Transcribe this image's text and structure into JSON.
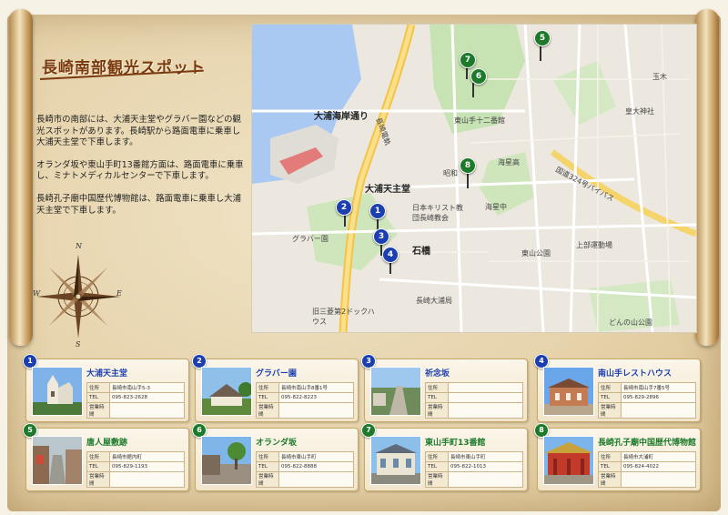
{
  "page": {
    "title": "長崎南部観光スポット",
    "intro": [
      "長崎市の南部には、大浦天主堂やグラバー園などの観光スポットがあります。長崎駅から路面電車に乗車し大浦天主堂で下車します。",
      "オランダ坂や東山手町13番館方面は、路面電車に乗車し、ミナトメディカルセンターで下車します。",
      "長崎孔子廟中国歴代博物館は、路面電車に乗車し大浦天主堂で下車します。"
    ]
  },
  "compass": {
    "n": "N",
    "s": "S",
    "e": "E",
    "w": "W"
  },
  "map": {
    "labels": {
      "oura_kaigan": "大浦海岸通り",
      "oura_tenshudo": "大浦天主堂",
      "ishibashi": "石橋",
      "glover": "グラバー園",
      "higashiyamate": "東山手十二番館",
      "kaiseiko": "海星高",
      "kaiseichu": "海星中",
      "showa": "昭和",
      "bypass": "国道324号バイパス",
      "nagasaki_oura": "長崎大浦局",
      "dock": "旧三菱第2ドックハウス",
      "donnoyama": "どんの山公園",
      "higashiyama_park": "東山公園",
      "kamiundo": "上部運動場",
      "jinja": "皇大神社",
      "tamagi": "玉木",
      "koshibyo": "日本キリスト教団長崎教会",
      "densha": "長崎電軌"
    },
    "markers": [
      "1",
      "2",
      "3",
      "4",
      "5",
      "6",
      "7",
      "8"
    ]
  },
  "labels": {
    "address": "住所",
    "tel": "TEL",
    "hours": "営業時間"
  },
  "spots": [
    {
      "num": "1",
      "name": "大浦天主堂",
      "address": "長崎市南山手5-3",
      "tel": "095-823-2628",
      "hours": ""
    },
    {
      "num": "2",
      "name": "グラバー園",
      "address": "長崎市南山手8番1号",
      "tel": "095-822-8223",
      "hours": ""
    },
    {
      "num": "3",
      "name": "祈念坂",
      "address": "",
      "tel": "",
      "hours": ""
    },
    {
      "num": "4",
      "name": "南山手レストハウス",
      "address": "長崎市南山手7番5号",
      "tel": "095-829-2896",
      "hours": ""
    },
    {
      "num": "5",
      "name": "唐人屋敷跡",
      "address": "長崎市館内町",
      "tel": "095-829-1193",
      "hours": ""
    },
    {
      "num": "6",
      "name": "オランダ坂",
      "address": "長崎市東山手町",
      "tel": "095-822-8888",
      "hours": ""
    },
    {
      "num": "7",
      "name": "東山手町13番館",
      "address": "長崎市東山手町",
      "tel": "095-822-1013",
      "hours": ""
    },
    {
      "num": "8",
      "name": "長崎孔子廟中国歴代博物館",
      "address": "長崎市大浦町",
      "tel": "095-824-4022",
      "hours": ""
    }
  ],
  "colors": {
    "blue": "#1c3fb0",
    "green": "#1c7a2a",
    "title": "#7a3a10"
  }
}
